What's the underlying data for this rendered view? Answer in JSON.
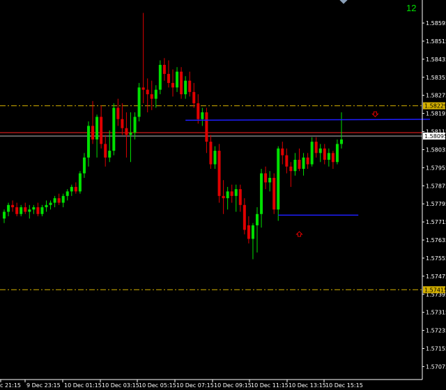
{
  "bar_counter": "12",
  "colors": {
    "background": "#000000",
    "bull": "#00e000",
    "bear": "#e00000",
    "axis_text": "#ffffff",
    "hline_dash": "#d4b000",
    "trend_blue": "#1e1eff",
    "bid_line": "#ff2020",
    "ask_line": "#c0c0c0"
  },
  "price_axis": {
    "ticks": [
      "1.58595",
      "1.58515",
      "1.58435",
      "1.58355",
      "1.58275",
      "1.58195",
      "1.58115",
      "1.58035",
      "1.57955",
      "1.57875",
      "1.57795",
      "1.57715",
      "1.57635",
      "1.57555",
      "1.57475",
      "1.57395",
      "1.57315",
      "1.57235",
      "1.57155",
      "1.57075"
    ],
    "highlight_labels": [
      "1.58229",
      "1.58095",
      "1.57415"
    ]
  },
  "time_axis": {
    "labels": [
      "c 21:15",
      "9 Dec 23:15",
      "10 Dec 01:15",
      "10 Dec 03:15",
      "10 Dec 05:15",
      "10 Dec 07:15",
      "10 Dec 09:15",
      "10 Dec 11:15",
      "10 Dec 13:15",
      "10 Dec 15:15"
    ]
  },
  "chart_data": {
    "type": "candlestick",
    "ylim": [
      1.5703,
      1.5866
    ],
    "levels": {
      "upper_dashdot": 1.58229,
      "bid": 1.5811,
      "ask": 1.58095,
      "lower_dashdot": 1.57415
    },
    "trend_lines": [
      {
        "from": [
          43,
          1.58165
        ],
        "to": [
          101,
          1.58169
        ]
      },
      {
        "from": [
          65,
          1.57745
        ],
        "to": [
          84,
          1.57745
        ]
      }
    ],
    "arrows": [
      {
        "type": "down",
        "x": 88,
        "y": 1.5819
      },
      {
        "type": "up",
        "x": 70,
        "y": 1.5766
      }
    ],
    "candles": [
      {
        "o": 1.5773,
        "h": 1.5777,
        "l": 1.5771,
        "c": 1.5776
      },
      {
        "o": 1.5776,
        "h": 1.578,
        "l": 1.5774,
        "c": 1.5779
      },
      {
        "o": 1.5779,
        "h": 1.5781,
        "l": 1.5776,
        "c": 1.5778
      },
      {
        "o": 1.5778,
        "h": 1.578,
        "l": 1.5774,
        "c": 1.5775
      },
      {
        "o": 1.5775,
        "h": 1.5779,
        "l": 1.5774,
        "c": 1.5778
      },
      {
        "o": 1.5778,
        "h": 1.578,
        "l": 1.5775,
        "c": 1.5776
      },
      {
        "o": 1.5776,
        "h": 1.5779,
        "l": 1.5773,
        "c": 1.5777
      },
      {
        "o": 1.5777,
        "h": 1.5779,
        "l": 1.5775,
        "c": 1.5778
      },
      {
        "o": 1.5778,
        "h": 1.578,
        "l": 1.5774,
        "c": 1.5775
      },
      {
        "o": 1.5775,
        "h": 1.5779,
        "l": 1.5774,
        "c": 1.5778
      },
      {
        "o": 1.5778,
        "h": 1.5781,
        "l": 1.5776,
        "c": 1.5779
      },
      {
        "o": 1.5779,
        "h": 1.5781,
        "l": 1.5777,
        "c": 1.578
      },
      {
        "o": 1.578,
        "h": 1.5783,
        "l": 1.5778,
        "c": 1.5782
      },
      {
        "o": 1.5782,
        "h": 1.5784,
        "l": 1.5779,
        "c": 1.578
      },
      {
        "o": 1.578,
        "h": 1.5784,
        "l": 1.5778,
        "c": 1.5783
      },
      {
        "o": 1.5783,
        "h": 1.5786,
        "l": 1.5781,
        "c": 1.5785
      },
      {
        "o": 1.5785,
        "h": 1.5788,
        "l": 1.5783,
        "c": 1.5787
      },
      {
        "o": 1.5787,
        "h": 1.5789,
        "l": 1.5784,
        "c": 1.5785
      },
      {
        "o": 1.5785,
        "h": 1.5794,
        "l": 1.5784,
        "c": 1.5793
      },
      {
        "o": 1.5793,
        "h": 1.5802,
        "l": 1.5791,
        "c": 1.58
      },
      {
        "o": 1.58,
        "h": 1.5816,
        "l": 1.5796,
        "c": 1.5814
      },
      {
        "o": 1.5814,
        "h": 1.5825,
        "l": 1.5806,
        "c": 1.5808
      },
      {
        "o": 1.5808,
        "h": 1.5819,
        "l": 1.58,
        "c": 1.5818
      },
      {
        "o": 1.5818,
        "h": 1.5823,
        "l": 1.5804,
        "c": 1.5806
      },
      {
        "o": 1.5806,
        "h": 1.581,
        "l": 1.5796,
        "c": 1.58
      },
      {
        "o": 1.58,
        "h": 1.5812,
        "l": 1.5798,
        "c": 1.5803
      },
      {
        "o": 1.5803,
        "h": 1.5824,
        "l": 1.5801,
        "c": 1.5822
      },
      {
        "o": 1.5822,
        "h": 1.5826,
        "l": 1.5814,
        "c": 1.5817
      },
      {
        "o": 1.5817,
        "h": 1.5824,
        "l": 1.581,
        "c": 1.5813
      },
      {
        "o": 1.5813,
        "h": 1.582,
        "l": 1.58,
        "c": 1.581
      },
      {
        "o": 1.581,
        "h": 1.582,
        "l": 1.5798,
        "c": 1.5811
      },
      {
        "o": 1.5811,
        "h": 1.582,
        "l": 1.5808,
        "c": 1.5818
      },
      {
        "o": 1.5818,
        "h": 1.5833,
        "l": 1.5816,
        "c": 1.5831
      },
      {
        "o": 1.5831,
        "h": 1.5864,
        "l": 1.5824,
        "c": 1.583
      },
      {
        "o": 1.583,
        "h": 1.5835,
        "l": 1.582,
        "c": 1.5828
      },
      {
        "o": 1.5828,
        "h": 1.5834,
        "l": 1.5821,
        "c": 1.5826
      },
      {
        "o": 1.5826,
        "h": 1.5832,
        "l": 1.5822,
        "c": 1.583
      },
      {
        "o": 1.583,
        "h": 1.5843,
        "l": 1.5828,
        "c": 1.5841
      },
      {
        "o": 1.5841,
        "h": 1.5844,
        "l": 1.5834,
        "c": 1.5837
      },
      {
        "o": 1.5837,
        "h": 1.5843,
        "l": 1.5831,
        "c": 1.5833
      },
      {
        "o": 1.5833,
        "h": 1.5839,
        "l": 1.5827,
        "c": 1.5831
      },
      {
        "o": 1.5831,
        "h": 1.584,
        "l": 1.5829,
        "c": 1.5838
      },
      {
        "o": 1.5838,
        "h": 1.584,
        "l": 1.5826,
        "c": 1.5828
      },
      {
        "o": 1.5828,
        "h": 1.5836,
        "l": 1.5826,
        "c": 1.5834
      },
      {
        "o": 1.5834,
        "h": 1.5838,
        "l": 1.5827,
        "c": 1.5829
      },
      {
        "o": 1.5829,
        "h": 1.5833,
        "l": 1.5822,
        "c": 1.5824
      },
      {
        "o": 1.5824,
        "h": 1.5828,
        "l": 1.5815,
        "c": 1.5817
      },
      {
        "o": 1.5817,
        "h": 1.5822,
        "l": 1.5814,
        "c": 1.582
      },
      {
        "o": 1.582,
        "h": 1.5822,
        "l": 1.5802,
        "c": 1.5807
      },
      {
        "o": 1.5807,
        "h": 1.581,
        "l": 1.5795,
        "c": 1.5797
      },
      {
        "o": 1.5797,
        "h": 1.5805,
        "l": 1.5795,
        "c": 1.5803
      },
      {
        "o": 1.5803,
        "h": 1.5806,
        "l": 1.578,
        "c": 1.5783
      },
      {
        "o": 1.5783,
        "h": 1.579,
        "l": 1.5775,
        "c": 1.5782
      },
      {
        "o": 1.5782,
        "h": 1.5787,
        "l": 1.5777,
        "c": 1.5785
      },
      {
        "o": 1.5785,
        "h": 1.5788,
        "l": 1.578,
        "c": 1.5783
      },
      {
        "o": 1.5783,
        "h": 1.5788,
        "l": 1.5776,
        "c": 1.5786
      },
      {
        "o": 1.5786,
        "h": 1.5788,
        "l": 1.5776,
        "c": 1.5779
      },
      {
        "o": 1.5779,
        "h": 1.5782,
        "l": 1.5766,
        "c": 1.5768
      },
      {
        "o": 1.577,
        "h": 1.5774,
        "l": 1.5762,
        "c": 1.5764
      },
      {
        "o": 1.5764,
        "h": 1.5771,
        "l": 1.5755,
        "c": 1.577
      },
      {
        "o": 1.577,
        "h": 1.5778,
        "l": 1.5758,
        "c": 1.5775
      },
      {
        "o": 1.5775,
        "h": 1.5795,
        "l": 1.5769,
        "c": 1.5793
      },
      {
        "o": 1.5793,
        "h": 1.5796,
        "l": 1.5786,
        "c": 1.5789
      },
      {
        "o": 1.5789,
        "h": 1.5794,
        "l": 1.5785,
        "c": 1.5791
      },
      {
        "o": 1.5791,
        "h": 1.5793,
        "l": 1.5775,
        "c": 1.5777
      },
      {
        "o": 1.5777,
        "h": 1.5805,
        "l": 1.5772,
        "c": 1.5804
      },
      {
        "o": 1.5804,
        "h": 1.5807,
        "l": 1.5797,
        "c": 1.5801
      },
      {
        "o": 1.5801,
        "h": 1.5804,
        "l": 1.5793,
        "c": 1.5796
      },
      {
        "o": 1.5796,
        "h": 1.5798,
        "l": 1.5787,
        "c": 1.5794
      },
      {
        "o": 1.5794,
        "h": 1.5802,
        "l": 1.5792,
        "c": 1.5799
      },
      {
        "o": 1.5799,
        "h": 1.5804,
        "l": 1.5794,
        "c": 1.5795
      },
      {
        "o": 1.5795,
        "h": 1.5802,
        "l": 1.5792,
        "c": 1.58
      },
      {
        "o": 1.58,
        "h": 1.5802,
        "l": 1.5795,
        "c": 1.5797
      },
      {
        "o": 1.5797,
        "h": 1.5809,
        "l": 1.5796,
        "c": 1.5807
      },
      {
        "o": 1.5807,
        "h": 1.5809,
        "l": 1.58,
        "c": 1.5802
      },
      {
        "o": 1.5802,
        "h": 1.5806,
        "l": 1.5798,
        "c": 1.5804
      },
      {
        "o": 1.5804,
        "h": 1.5806,
        "l": 1.5797,
        "c": 1.5799
      },
      {
        "o": 1.5799,
        "h": 1.5804,
        "l": 1.5796,
        "c": 1.5802
      },
      {
        "o": 1.5802,
        "h": 1.5803,
        "l": 1.5795,
        "c": 1.5798
      },
      {
        "o": 1.5798,
        "h": 1.5808,
        "l": 1.5797,
        "c": 1.5806
      },
      {
        "o": 1.5806,
        "h": 1.582,
        "l": 1.5804,
        "c": 1.5808
      }
    ]
  }
}
